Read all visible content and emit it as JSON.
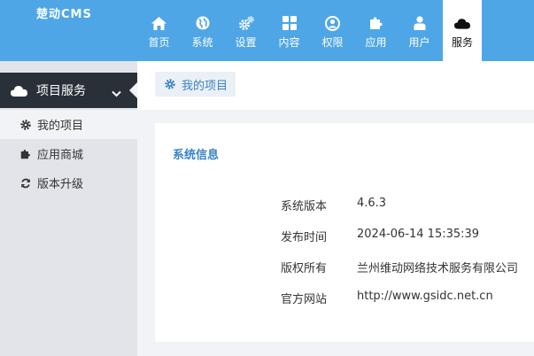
{
  "app": {
    "logo": "楚动CMS"
  },
  "nav": {
    "items": [
      {
        "label": "首页",
        "icon": "home-icon"
      },
      {
        "label": "系统",
        "icon": "globe-icon"
      },
      {
        "label": "设置",
        "icon": "cogs-icon"
      },
      {
        "label": "内容",
        "icon": "grid-icon"
      },
      {
        "label": "权限",
        "icon": "user-circle-icon"
      },
      {
        "label": "应用",
        "icon": "puzzle-icon"
      },
      {
        "label": "用户",
        "icon": "user-icon"
      },
      {
        "label": "服务",
        "icon": "cloud-icon",
        "active": true
      }
    ]
  },
  "sidebar": {
    "header": {
      "label": "项目服务",
      "icon": "cloud-icon"
    },
    "items": [
      {
        "label": "我的项目",
        "icon": "gear-icon",
        "active": true
      },
      {
        "label": "应用商城",
        "icon": "puzzle-icon"
      },
      {
        "label": "版本升级",
        "icon": "refresh-icon"
      }
    ]
  },
  "breadcrumb": {
    "label": "我的项目",
    "icon": "gear-icon"
  },
  "panel": {
    "title": "系统信息",
    "rows": [
      {
        "key": "系统版本",
        "value": "4.6.3"
      },
      {
        "key": "发布时间",
        "value": "2024-06-14 15:35:39"
      },
      {
        "key": "版权所有",
        "value": "兰州维动网络技术服务有限公司"
      },
      {
        "key": "官方网站",
        "value": "http://www.gsidc.net.cn"
      }
    ]
  },
  "colors": {
    "header": "#4fa6e6",
    "sidebar_dark": "#2a3038",
    "sidebar_bg": "#e2e4ea",
    "accent": "#3a82c4"
  }
}
